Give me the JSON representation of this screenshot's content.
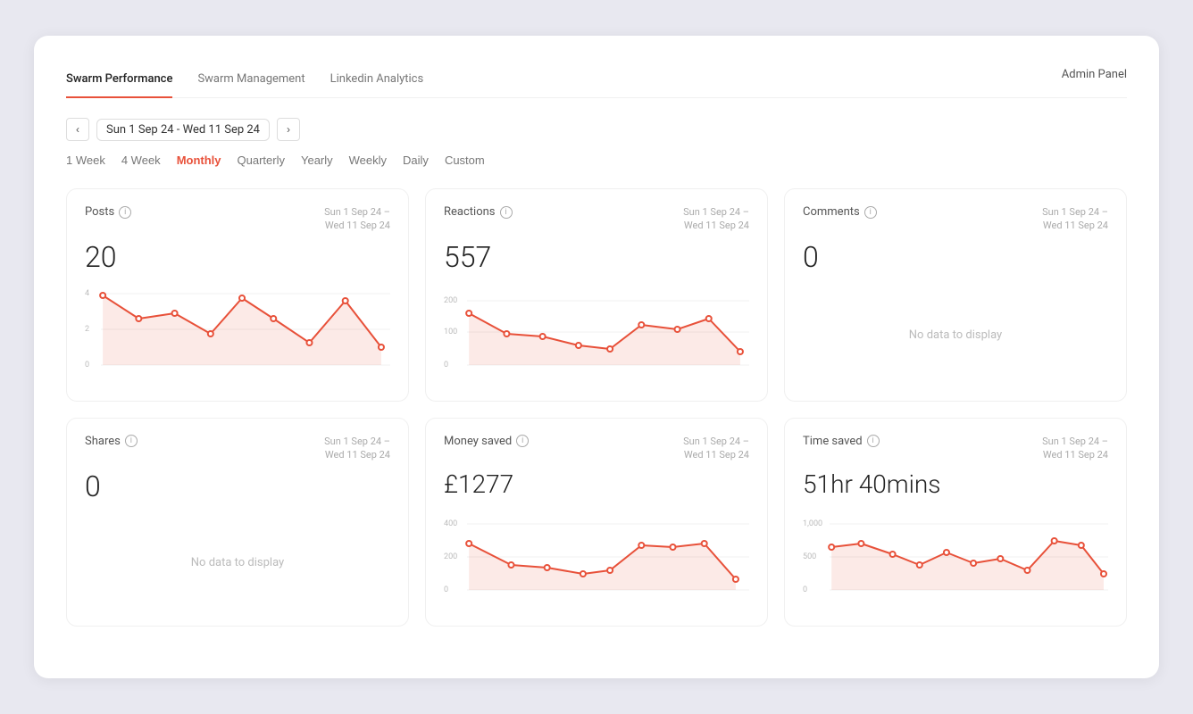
{
  "nav": {
    "tabs": [
      {
        "label": "Swarm Performance",
        "active": true
      },
      {
        "label": "Swarm Management",
        "active": false
      },
      {
        "label": "Linkedin Analytics",
        "active": false
      }
    ],
    "admin_panel": "Admin Panel"
  },
  "date": {
    "range": "Sun 1 Sep 24 - Wed 11 Sep 24",
    "prev": "<",
    "next": ">"
  },
  "periods": [
    {
      "label": "1 Week",
      "active": false
    },
    {
      "label": "4 Week",
      "active": false
    },
    {
      "label": "Monthly",
      "active": true
    },
    {
      "label": "Quarterly",
      "active": false
    },
    {
      "label": "Yearly",
      "active": false
    },
    {
      "label": "Weekly",
      "active": false
    },
    {
      "label": "Daily",
      "active": false
    },
    {
      "label": "Custom",
      "active": false
    }
  ],
  "cards": [
    {
      "id": "posts",
      "title": "Posts",
      "value": "20",
      "date": "Sun 1 Sep 24 –\nWed 11 Sep 24",
      "has_chart": true,
      "no_data": false,
      "chart_type": "posts"
    },
    {
      "id": "reactions",
      "title": "Reactions",
      "value": "557",
      "date": "Sun 1 Sep 24 –\nWed 11 Sep 24",
      "has_chart": true,
      "no_data": false,
      "chart_type": "reactions"
    },
    {
      "id": "comments",
      "title": "Comments",
      "value": "0",
      "date": "Sun 1 Sep 24 –\nWed 11 Sep 24",
      "has_chart": false,
      "no_data": true,
      "no_data_label": "No data to display"
    },
    {
      "id": "shares",
      "title": "Shares",
      "value": "0",
      "date": "Sun 1 Sep 24 –\nWed 11 Sep 24",
      "has_chart": false,
      "no_data": true,
      "no_data_label": "No data to display"
    },
    {
      "id": "money-saved",
      "title": "Money saved",
      "value": "£1277",
      "date": "Sun 1 Sep 24 –\nWed 11 Sep 24",
      "has_chart": true,
      "no_data": false,
      "chart_type": "money"
    },
    {
      "id": "time-saved",
      "title": "Time saved",
      "value": "51hr 40mins",
      "date": "Sun 1 Sep 24 –\nWed 11 Sep 24",
      "has_chart": true,
      "no_data": false,
      "chart_type": "time"
    }
  ]
}
